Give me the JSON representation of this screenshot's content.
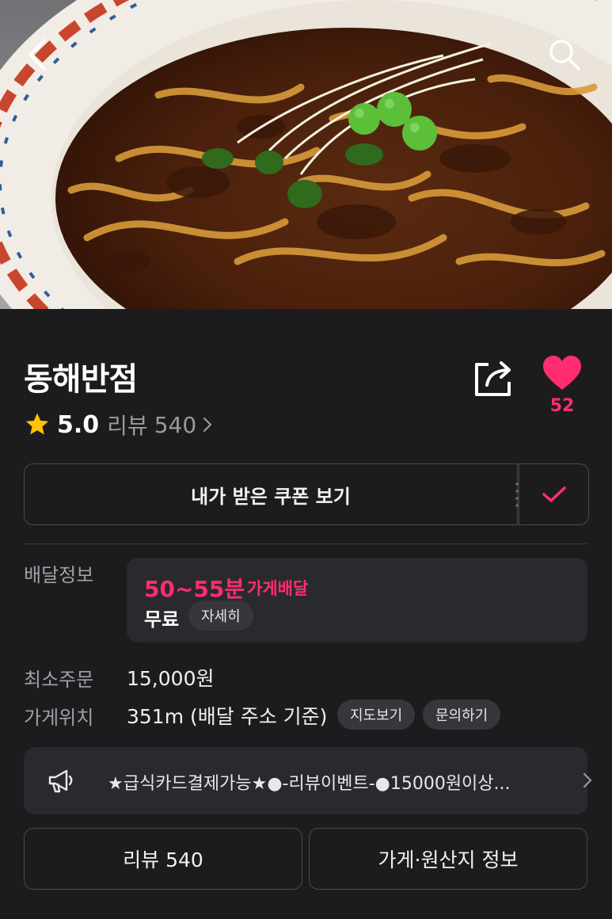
{
  "hero": {
    "image_icon": "jjajangmyeon-photo",
    "back_icon": "chevron-left-icon",
    "search_icon": "search-icon"
  },
  "store": {
    "name": "동해반점",
    "rating": "5.0",
    "review_label": "리뷰",
    "review_count": "540",
    "share_icon": "share-icon",
    "like_icon": "heart-icon",
    "like_count": "52"
  },
  "coupon": {
    "label": "내가 받은 쿠폰 보기",
    "check_icon": "check-icon"
  },
  "delivery": {
    "label": "배달정보",
    "time": "50~55분",
    "type": "가게배달",
    "fee": "무료",
    "detail_button": "자세히"
  },
  "min_order": {
    "label": "최소주문",
    "value": "15,000원"
  },
  "location": {
    "label": "가게위치",
    "value": "351m (배달 주소 기준)",
    "map_button": "지도보기",
    "inquiry_button": "문의하기"
  },
  "notice": {
    "icon": "megaphone-icon",
    "text": "★급식카드결제가능★●-리뷰이벤트-●15000원이상..."
  },
  "bottom": {
    "review_button": "리뷰 540",
    "info_button": "가게·원산지 정보"
  },
  "colors": {
    "background": "#1c1c1e",
    "accent": "#ff2d6f",
    "star": "#ffc400",
    "panel": "#2a2a2e"
  }
}
